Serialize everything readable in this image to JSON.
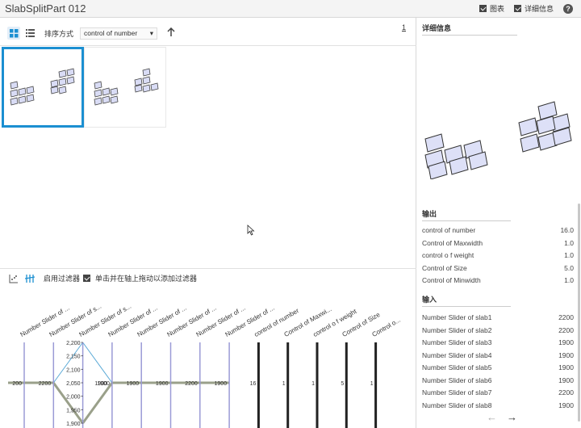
{
  "window": {
    "title": "SlabSplitPart 012"
  },
  "header": {
    "chart_label": "图表",
    "details_label": "详细信息",
    "help_glyph": "?"
  },
  "toolbar": {
    "sort_label": "排序方式",
    "sort_value": "control of number",
    "page": "1"
  },
  "filter": {
    "enable_label": "启用过滤器",
    "hint": "单击并在轴上拖动以添加过滤器"
  },
  "pcoords": {
    "axes": [
      {
        "label": "Number Slider of ...",
        "value": "200"
      },
      {
        "label": "Number Slider of s...",
        "value": "2200"
      },
      {
        "label": "Number Slider of s...",
        "ticks": [
          "2,200",
          "2,150",
          "2,100",
          "2,050",
          "2,000",
          "1,950",
          "1,900"
        ]
      },
      {
        "label": "Number Slider of ...",
        "value": "1900"
      },
      {
        "label": "Number Slider of ...",
        "value": "1900"
      },
      {
        "label": "Number Slider of ...",
        "value": "1900"
      },
      {
        "label": "Number Slider of ...",
        "value": "2200"
      },
      {
        "label": "Number Slider of ...",
        "value": "1900"
      },
      {
        "label": "control of number",
        "value": "16"
      },
      {
        "label": "Control of Maxwi...",
        "value": "1"
      },
      {
        "label": "control o f weight",
        "value": "1"
      },
      {
        "label": "Control of Size",
        "value": "5"
      },
      {
        "label": "Control o...",
        "value": "1"
      }
    ],
    "selected_axis_value": "1900",
    "line_color": "#9aa08a",
    "highlight_color": "#5aa9d6"
  },
  "details": {
    "title": "详细信息",
    "output_title": "输出",
    "outputs": [
      {
        "name": "control of number",
        "value": "16.0"
      },
      {
        "name": "Control of Maxwidth",
        "value": "1.0"
      },
      {
        "name": "control o f weight",
        "value": "1.0"
      },
      {
        "name": "Control of Size",
        "value": "5.0"
      },
      {
        "name": "Control of Minwidth",
        "value": "1.0"
      }
    ],
    "input_title": "输入",
    "inputs": [
      {
        "name": "Number Slider of slab1",
        "value": "2200"
      },
      {
        "name": "Number Slider of slab2",
        "value": "2200"
      },
      {
        "name": "Number Slider of slab3",
        "value": "1900"
      },
      {
        "name": "Number Slider of slab4",
        "value": "1900"
      },
      {
        "name": "Number Slider of slab5",
        "value": "1900"
      },
      {
        "name": "Number Slider of slab6",
        "value": "1900"
      },
      {
        "name": "Number Slider of slab7",
        "value": "2200"
      },
      {
        "name": "Number Slider of slab8",
        "value": "1900"
      }
    ]
  },
  "nav": {
    "prev": "←",
    "next": "→"
  },
  "colors": {
    "accent": "#1b8fd1",
    "slab_fill": "#d9dcf5",
    "slab_edge": "#444444"
  }
}
